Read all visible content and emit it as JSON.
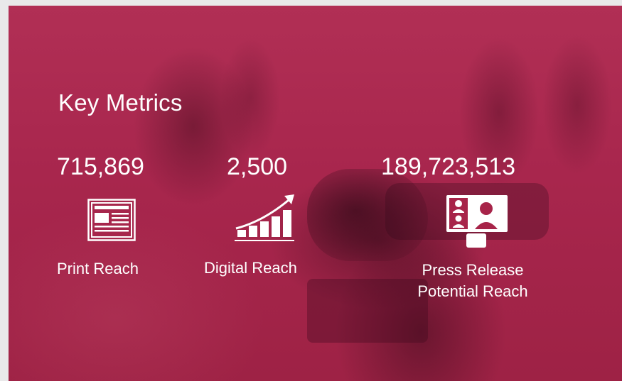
{
  "title": "Key Metrics",
  "colors": {
    "panel": "#a72449",
    "text": "#ffffff",
    "page_background": "#e9e9ea"
  },
  "metrics": [
    {
      "value": "715,869",
      "label": "Print Reach",
      "icon": "newspaper-icon"
    },
    {
      "value": "2,500",
      "label": "Digital Reach",
      "icon": "growth-chart-icon"
    },
    {
      "value": "189,723,513",
      "label_lines": [
        "Press Release",
        "Potential Reach"
      ],
      "icon": "video-conference-icon"
    }
  ]
}
